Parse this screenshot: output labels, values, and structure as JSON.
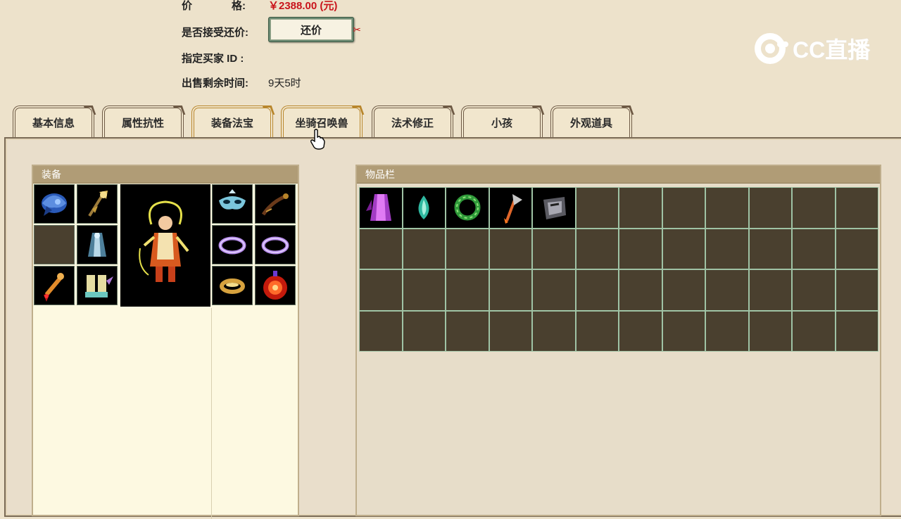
{
  "info": {
    "price_label_a": "价",
    "price_label_b": "格:",
    "price_value": "￥2388.00 (元)",
    "bargain_label": "是否接受还价:",
    "bargain_button": "还价",
    "buyer_id_label": "指定买家 ID :",
    "time_left_label": "出售剩余时间:",
    "time_left_value": "9天5时"
  },
  "logo": {
    "text": "CC直播"
  },
  "tabs": [
    {
      "label": "基本信息",
      "active": false
    },
    {
      "label": "属性抗性",
      "active": false
    },
    {
      "label": "装备法宝",
      "active": true
    },
    {
      "label": "坐骑召唤兽",
      "active": true
    },
    {
      "label": "法术修正",
      "active": false
    },
    {
      "label": "小孩",
      "active": false
    },
    {
      "label": "外观道具",
      "active": false
    }
  ],
  "equipment": {
    "title": "装备",
    "slots": [
      "blue-helmet",
      "golden-scepter",
      "empty",
      "blue-cloak",
      "red-tassel-charm",
      "winged-boots",
      "blue-mask",
      "dark-flail",
      "purple-ring-1",
      "purple-ring-2",
      "gold-ring",
      "red-orb-talisman"
    ],
    "portrait": "character-portrait"
  },
  "inventory": {
    "title": "物品栏",
    "columns": 12,
    "rows": 4,
    "items": [
      "purple-robe",
      "teal-gem",
      "green-wreath",
      "fire-axe",
      "dark-armor"
    ]
  },
  "colors": {
    "price": "#c9141b",
    "panel_header": "#b09c76",
    "empty_slot": "#4a402f",
    "grid_line": "#9fc3a5"
  }
}
